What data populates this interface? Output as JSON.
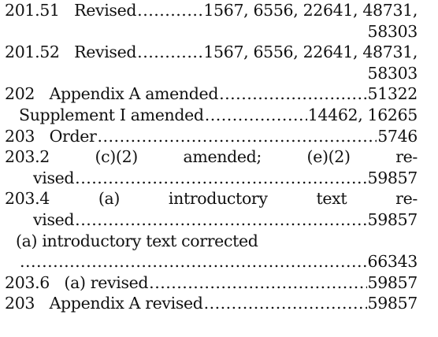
{
  "entries": [
    {
      "label": "201.51   Revised",
      "pages": "1567, 6556, 22641, 48731,"
    },
    {
      "cont": "58303"
    },
    {
      "label": "201.52   Revised",
      "pages": "1567, 6556, 22641, 48731,"
    },
    {
      "cont": "58303"
    },
    {
      "label": "202   Appendix A amended",
      "pages": "51322"
    },
    {
      "label": "Supplement I amended",
      "pages": "14462, 16265"
    },
    {
      "label": "203   Order",
      "pages": "5746"
    },
    {
      "text": "203.2   (c)(2)   amended;   (e)(2)   re-"
    },
    {
      "label": "vised",
      "pages": "59857"
    },
    {
      "text": "203.4   (a)   introductory   text   re-"
    },
    {
      "label": "vised",
      "pages": "59857"
    },
    {
      "text": "(a) introductory text corrected"
    },
    {
      "label": "",
      "pages": "66343"
    },
    {
      "label": "203.6   (a) revised",
      "pages": "59857"
    },
    {
      "label": "203   Appendix A revised",
      "pages": "59857"
    }
  ]
}
